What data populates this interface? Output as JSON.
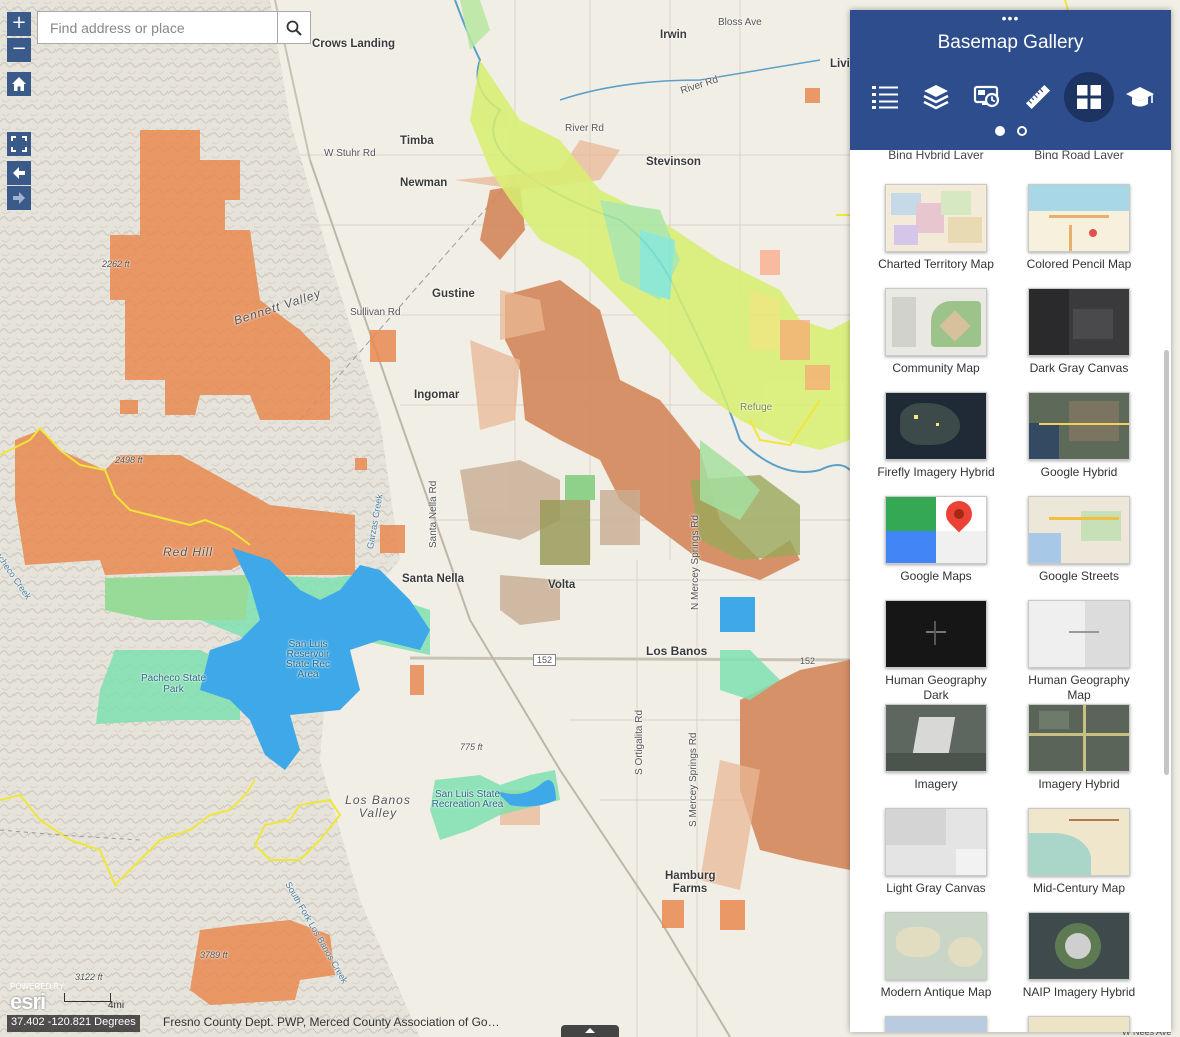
{
  "search": {
    "placeholder": "Find address or place"
  },
  "zoom": {
    "in_label": "+",
    "out_label": "−"
  },
  "map_labels": {
    "towns": [
      "Crows Landing",
      "Timba",
      "Newman",
      "Stevinson",
      "Irwin",
      "Livin",
      "Gustine",
      "Ingomar",
      "Santa Nella",
      "Volta",
      "Los Banos",
      "Hamburg Farms"
    ],
    "roads": [
      "Bloss Ave",
      "River Rd",
      "River Rd",
      "W Stuhr Rd",
      "Sullivan Rd",
      "Santa Nella Rd",
      "N Mercey Springs Rd",
      "S Ortigalita Rd",
      "S Mercey Springs Rd",
      "152",
      "152"
    ],
    "areas": [
      "San Luis Reservoir State Rec Area",
      "Pacheco State Park",
      "San Luis State Recreation Area",
      "Refuge"
    ],
    "elevations": [
      "2262 ft",
      "2498 ft",
      "775 ft",
      "3789 ft",
      "3122 ft"
    ],
    "valleys": [
      "Bennett Valley",
      "Red Hill",
      "Los Banos Valley"
    ],
    "creeks": [
      "Garzas Creek",
      "South Fork Los Banos Creek",
      "Pacheco Creek"
    ]
  },
  "panel": {
    "title": "Basemap Gallery",
    "grip": "•••",
    "toolbar": [
      {
        "name": "legend",
        "icon": "list-icon",
        "active": false
      },
      {
        "name": "layers",
        "icon": "layers-icon",
        "active": false
      },
      {
        "name": "bookmarks",
        "icon": "screen-bookmark-icon",
        "active": false
      },
      {
        "name": "measure",
        "icon": "ruler-icon",
        "active": false
      },
      {
        "name": "basemap-gallery",
        "icon": "grid-icon",
        "active": true
      },
      {
        "name": "about",
        "icon": "mortarboard-icon",
        "active": false
      }
    ],
    "pager_dots": 2,
    "cut_labels": [
      "Bing Hybrid Layer",
      "Bing Road Layer"
    ],
    "basemaps": [
      "Charted Territory Map",
      "Colored Pencil Map",
      "Community Map",
      "Dark Gray Canvas",
      "Firefly Imagery Hybrid",
      "Google Hybrid",
      "Google Maps",
      "Google Streets",
      "Human Geography Dark",
      "Human Geography Map",
      "Imagery",
      "Imagery Hybrid",
      "Light Gray Canvas",
      "Mid-Century Map",
      "Modern Antique Map",
      "NAIP Imagery Hybrid"
    ]
  },
  "status": {
    "coordinates": "37.402 -120.821 Degrees",
    "attribution": "Fresno County Dept. PWP, Merced County Association of Go…",
    "scale": "4mi",
    "powered_by": "POWERED BY",
    "esri": "esri",
    "bottom_road": "W Nees Ave"
  },
  "colors": {
    "panel_header": "#2e4d8c",
    "map_button": "#3a5a8a",
    "orange_lands": "#e88a50",
    "water": "#3ea8e8",
    "green": "#7fe0b0",
    "lime": "#d8f070"
  }
}
